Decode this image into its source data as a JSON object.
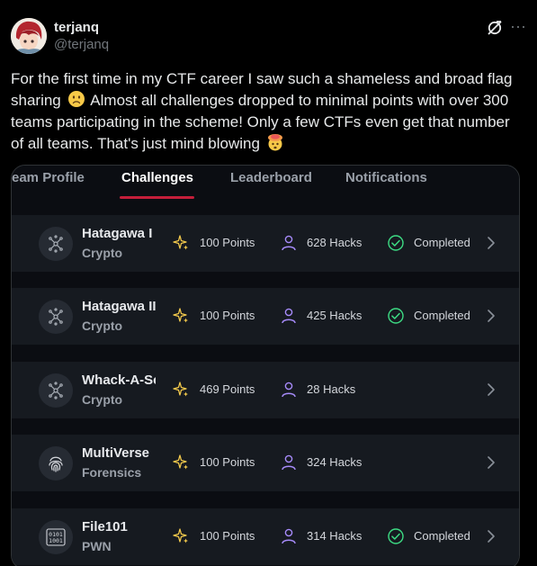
{
  "author": {
    "display_name": "terjanq",
    "handle": "@terjanq"
  },
  "header_icons": [
    "grok-icon",
    "more-icon"
  ],
  "more_glyph": "···",
  "tweet": {
    "text_part1": "For the first time in my CTF career I saw such a shameless and broad flag sharing",
    "emoji1": "slightly-frowning-face",
    "text_part2": "Almost all challenges dropped to minimal points with over 300 teams participating in the scheme! Only a few CTFs even get that number of all teams. That's just mind blowing",
    "emoji2": "exploding-head"
  },
  "screenshot": {
    "tabs": [
      {
        "label": "eam Profile"
      },
      {
        "label": "Challenges"
      },
      {
        "label": "Leaderboard"
      },
      {
        "label": "Notifications"
      }
    ],
    "active_tab": "Challenges",
    "challenges": [
      {
        "name": "Hatagawa I",
        "category": "Crypto",
        "points": "100 Points",
        "hacks": "628 Hacks",
        "status": "Completed",
        "icon": "crypto-icon"
      },
      {
        "name": "Hatagawa II",
        "category": "Crypto",
        "points": "100 Points",
        "hacks": "425 Hacks",
        "status": "Completed",
        "icon": "crypto-icon"
      },
      {
        "name": "Whack-A-Scheme",
        "category": "Crypto",
        "points": "469 Points",
        "hacks": "28 Hacks",
        "status": "",
        "icon": "crypto-icon"
      },
      {
        "name": "MultiVerse",
        "category": "Forensics",
        "points": "100 Points",
        "hacks": "324 Hacks",
        "status": "",
        "icon": "fingerprint-icon"
      },
      {
        "name": "File101",
        "category": "PWN",
        "points": "100 Points",
        "hacks": "314 Hacks",
        "status": "Completed",
        "icon": "binary-icon"
      }
    ],
    "colors": {
      "points_icon": "#f2c94c",
      "hacks_icon": "#a78bfa",
      "completed_icon": "#3ddc84",
      "active_tab_underline": "#c41e3a"
    }
  }
}
